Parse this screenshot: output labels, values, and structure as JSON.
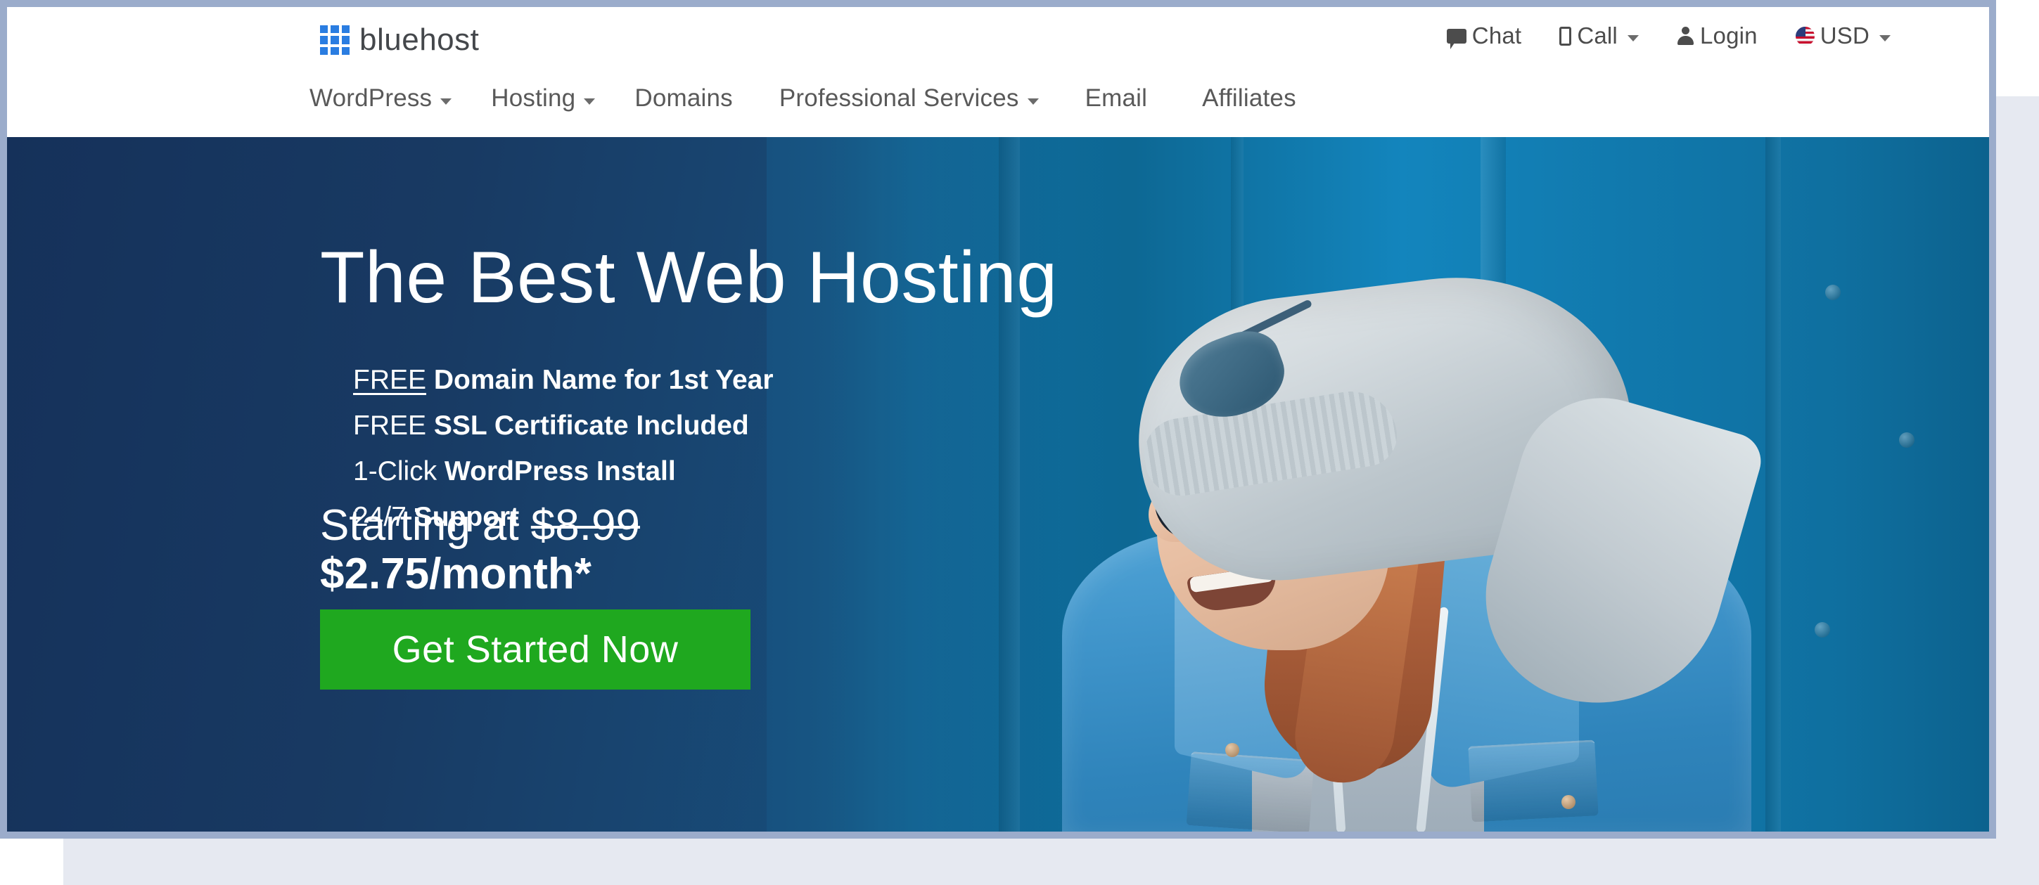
{
  "brand": {
    "name": "bluehost",
    "logo_icon": "grid-squares-icon",
    "logo_color": "#2A7DE1"
  },
  "utility_nav": {
    "items": [
      {
        "label": "Chat",
        "icon": "chat-bubble-icon",
        "caret": false
      },
      {
        "label": "Call",
        "icon": "phone-icon",
        "caret": true
      },
      {
        "label": "Login",
        "icon": "person-icon",
        "caret": false
      },
      {
        "label": "USD",
        "icon": "us-flag-icon",
        "caret": true
      }
    ]
  },
  "main_nav": {
    "items": [
      {
        "label": "WordPress",
        "caret": true
      },
      {
        "label": "Hosting",
        "caret": true
      },
      {
        "label": "Domains",
        "caret": false
      },
      {
        "label": "Professional Services",
        "caret": true
      },
      {
        "label": "Email",
        "caret": false
      },
      {
        "label": "Affiliates",
        "caret": false
      }
    ]
  },
  "hero": {
    "headline": "The Best Web Hosting",
    "features": [
      {
        "lead": "FREE",
        "lead_underline": true,
        "rest": " Domain Name for 1st Year"
      },
      {
        "lead": "FREE",
        "lead_underline": false,
        "rest": " SSL Certificate Included"
      },
      {
        "lead": "1-Click",
        "lead_underline": false,
        "rest": " WordPress Install"
      },
      {
        "lead": "24/7",
        "lead_underline": false,
        "rest": " Support"
      }
    ],
    "price_prefix": "Starting at ",
    "price_old": "$8.99",
    "price_new": "$2.75/month*",
    "cta_label": "Get Started Now",
    "cta_color": "#1FA81F",
    "bg_color_left": "#15315a",
    "bg_color_right": "#1076ab",
    "image_alt": "Smiling woman wearing glasses, grey beanie and denim jacket in front of a blue door"
  }
}
